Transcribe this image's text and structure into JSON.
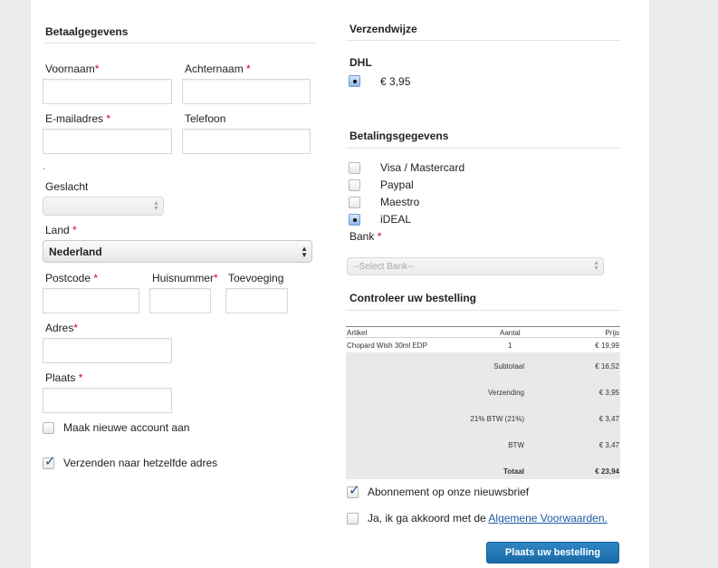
{
  "billing": {
    "title": "Betaalgegevens",
    "first_name_label": "Voornaam",
    "last_name_label": "Achternaam",
    "email_label": "E-mailadres",
    "phone_label": "Telefoon",
    "dot_text": ".",
    "gender_label": "Geslacht",
    "gender_value": "",
    "country_label": "Land",
    "country_value": "Nederland",
    "postcode_label": "Postcode",
    "house_number_label": "Huisnummer",
    "addition_label": "Toevoeging",
    "address_label": "Adres",
    "city_label": "Plaats",
    "required_marker": "*",
    "create_account_label": "Maak nieuwe account aan",
    "create_account_checked": false,
    "same_address_label": "Verzenden naar hetzelfde adres",
    "same_address_checked": true
  },
  "shipping": {
    "title": "Verzendwijze",
    "carrier": "DHL",
    "price": "€ 3,95",
    "selected": true
  },
  "payment": {
    "title": "Betalingsgegevens",
    "options": [
      {
        "label": "Visa / Mastercard",
        "selected": false
      },
      {
        "label": "Paypal",
        "selected": false
      },
      {
        "label": "Maestro",
        "selected": false
      },
      {
        "label": "iDEAL",
        "selected": true
      }
    ],
    "bank_label": "Bank",
    "bank_placeholder": "--Select Bank--"
  },
  "order": {
    "title": "Controleer uw bestelling",
    "columns": {
      "article": "Artikel",
      "quantity": "Aantal",
      "price": "Prijs"
    },
    "items": [
      {
        "name": "Chopard Wish 30ml EDP",
        "quantity": "1",
        "price": "€ 19,99"
      }
    ],
    "totals": [
      {
        "label": "Subtotaal",
        "value": "€ 16,52"
      },
      {
        "label": "Verzending",
        "value": "€ 3,95"
      },
      {
        "label": "21% BTW (21%)",
        "value": "€ 3,47"
      },
      {
        "label": "BTW",
        "value": "€ 3,47"
      },
      {
        "label": "Totaal",
        "value": "€ 23,94"
      }
    ],
    "newsletter_label": "Abonnement op onze nieuwsbrief",
    "newsletter_checked": true,
    "terms_prefix": "Ja, ik ga akkoord met de ",
    "terms_link": "Algemene Voorwaarden.",
    "terms_checked": false,
    "submit_label": "Plaats uw bestelling"
  },
  "colors": {
    "accent": "#1b6ba8",
    "required": "#d0021b",
    "link": "#1a5da3"
  }
}
